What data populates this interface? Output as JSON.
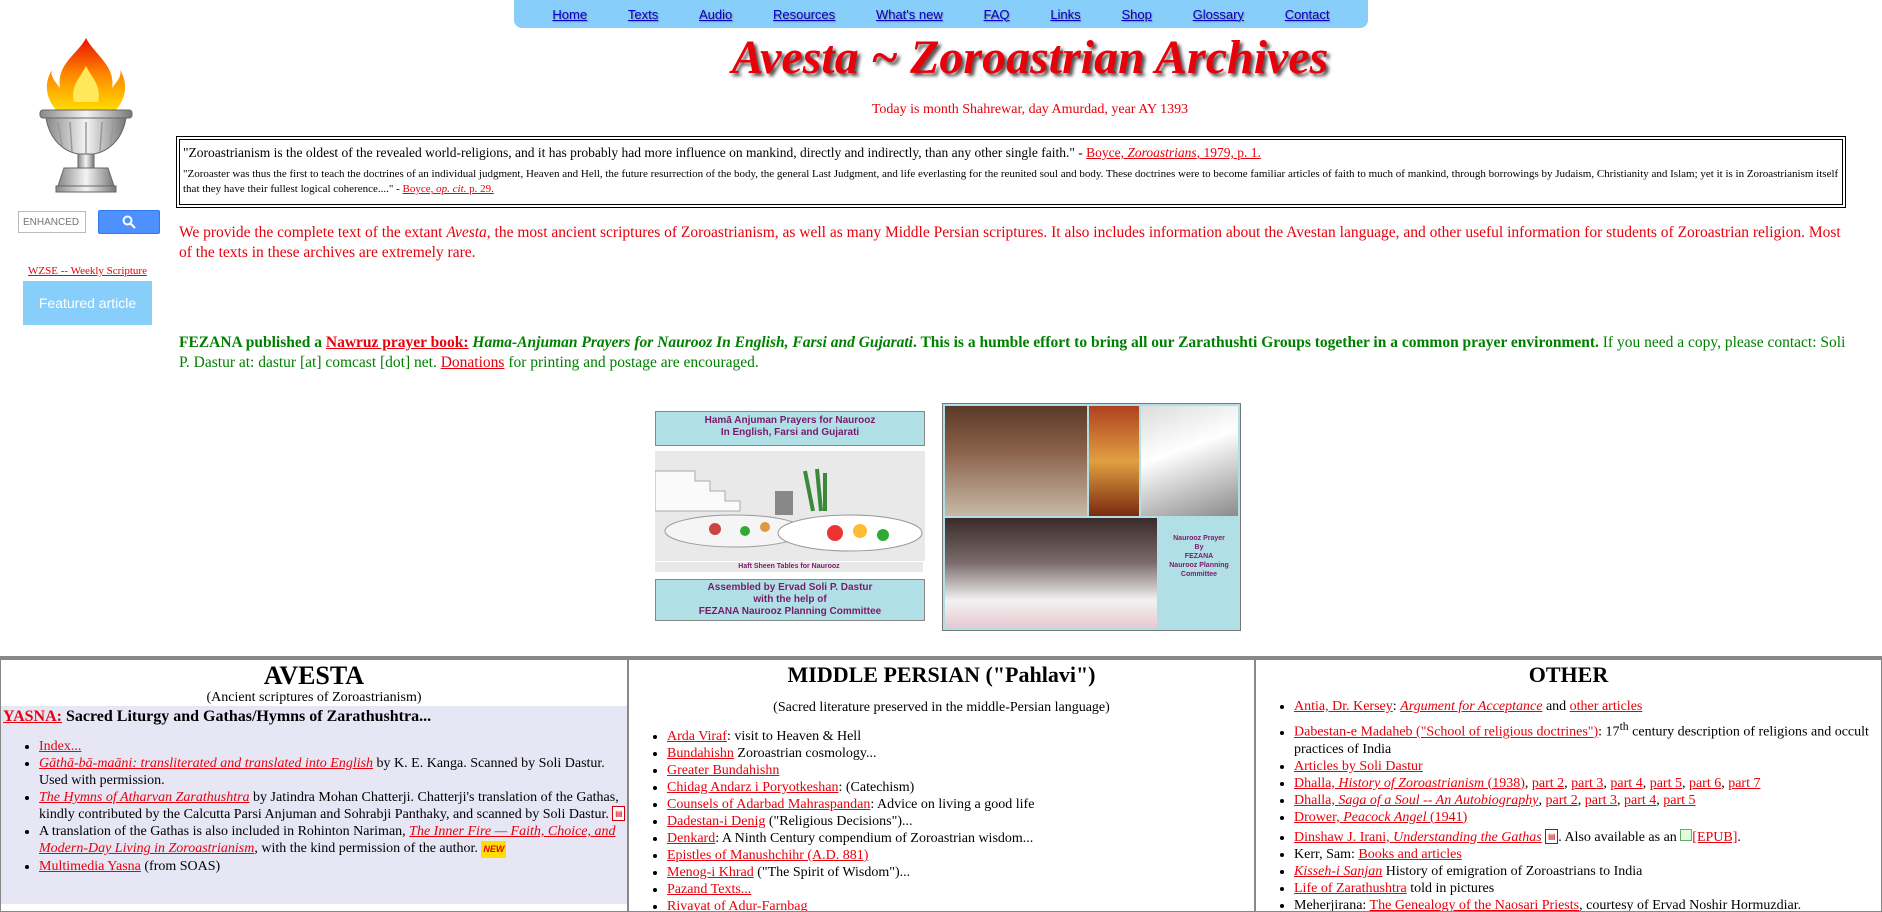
{
  "nav": [
    "Home",
    "Texts",
    "Audio",
    "Resources",
    "What's new",
    "FAQ",
    "Links",
    "Shop",
    "Glossary",
    "Contact"
  ],
  "title": "Avesta ~ Zoroastrian Archives",
  "today": "Today is month Shahrewar, day Amurdad, year AY 1393",
  "search": {
    "placeholder": "ENHANCED BY Google"
  },
  "wzse": "WZSE -- Weekly Scripture",
  "featured": "Featured article",
  "quotes": {
    "q1_text": "\"Zoroastrianism is the oldest of the revealed world-religions, and it has probably had more influence on mankind, directly and indirectly, than any other single faith.\" - ",
    "q1_cite_a": "Boyce, ",
    "q1_cite_b": "Zoroastrians",
    "q1_cite_c": ", 1979, p. 1.",
    "q2_text": "\"Zoroaster was thus the first to teach the doctrines of an individual judgment, Heaven and Hell, the future resurrection of the body, the general Last Judgment, and life everlasting for the reunited soul and body. These doctrines were to become familiar articles of faith to much of mankind, through borrowings by Judaism, Christianity and Islam; yet it is in Zoroastrianism itself that they have their fullest logical coherence....\" - ",
    "q2_cite_a": "Boyce, ",
    "q2_cite_b": "op. cit.",
    "q2_cite_c": " p. 29."
  },
  "intro": {
    "a": "We provide the complete text of the extant ",
    "b": "Avesta",
    "c": ", the most ancient scriptures of Zoroastrianism, as well as many Middle Persian scriptures. It also includes information about the Avestan language, and other useful information for students of Zoroastrian religion. Most of the texts in these archives are extremely rare."
  },
  "fezana": {
    "a": "FEZANA published a ",
    "link": "Nawruz prayer book:",
    "b": " Hama-Anjuman Prayers for Naurooz In English, Farsi and Gujarati",
    "c": ". This is a humble effort to bring all our Zarathushti Groups together in a common prayer environment.",
    "d": " If you need a copy, please contact: Soli P. Dastur at: dastur [at] comcast [dot] net. ",
    "donations": "Donations",
    "e": " for printing and postage are encouraged."
  },
  "flyer": {
    "top": "Hamā Anjuman Prayers for Naurooz\nIn English, Farsi and Gujarati",
    "caption": "Haft Sheen Tables for Naurooz",
    "bottom": "Assembled by Ervad Soli P. Dastur\nwith the help of\nFEZANA Naurooz Planning Committee",
    "right_label": "Naurooz Prayer\nBy\nFEZANA\nNaurooz Planning\nCommittee"
  },
  "avesta": {
    "heading": "AVESTA",
    "sub": "(Ancient scriptures of Zoroastrianism)",
    "yasna_link": "YASNA:",
    "yasna_text": " Sacred Liturgy and Gathas/Hymns of Zarathushtra...",
    "items": [
      {
        "link": "Index...",
        "text": ""
      },
      {
        "link": "Gāthā-bā-maāni: transliterated and translated into English",
        "text": " by K. E. Kanga. Scanned by Soli Dastur. Used with permission."
      },
      {
        "link": "The Hymns of Atharvan Zarathushtra",
        "text": " by Jatindra Mohan Chatterji. Chatterji's translation of the Gathas, kindly contributed by the Calcutta Parsi Anjuman and Sohrabji Panthaky, and scanned by Soli Dastur."
      },
      {
        "pre": "A translation of the Gathas is also included in Rohinton Nariman, ",
        "link": "The Inner Fire — Faith, Choice, and Modern-Day Living in Zoroastrianism",
        "text": ", with the kind permission of the author."
      },
      {
        "link": "Multimedia Yasna",
        "text": " (from SOAS)"
      }
    ],
    "new_badge": "NEW"
  },
  "pahlavi": {
    "heading": "MIDDLE PERSIAN (\"Pahlavi\")",
    "sub": "(Sacred literature preserved in the middle-Persian language)",
    "items": [
      {
        "link": "Arda Viraf",
        "text": ": visit to Heaven & Hell"
      },
      {
        "link": "Bundahishn",
        "text": " Zoroastrian cosmology..."
      },
      {
        "link": "Greater Bundahishn",
        "text": ""
      },
      {
        "link": "Chidag Andarz i Poryotkeshan",
        "text": ": (Catechism)"
      },
      {
        "link": "Counsels of Adarbad Mahraspandan",
        "text": ": Advice on living a good life"
      },
      {
        "link": "Dadestan-i Denig",
        "text": " (\"Religious Decisions\")..."
      },
      {
        "link": "Denkard",
        "text": ": A Ninth Century compendium of Zoroastrian wisdom..."
      },
      {
        "link": "Epistles of Manushchihr (A.D. 881)",
        "text": ""
      },
      {
        "link": "Menog-i Khrad",
        "text": " (\"The Spirit of Wisdom\")..."
      },
      {
        "link": "Pazand Texts...",
        "text": ""
      },
      {
        "link": "Rivayat of Adur-Farnbag",
        "text": ""
      }
    ]
  },
  "other": {
    "heading": "OTHER",
    "items": [
      {
        "html": "antia"
      },
      {
        "html": "dabestan"
      },
      {
        "html": "soli"
      },
      {
        "html": "dhalla1"
      },
      {
        "html": "dhalla2"
      },
      {
        "html": "drower"
      },
      {
        "html": "irani"
      },
      {
        "html": "kerr"
      },
      {
        "html": "kisseh"
      },
      {
        "html": "life"
      },
      {
        "html": "meherjirana"
      }
    ],
    "antia": {
      "a": "Antia, Dr. Kersey",
      "b": ": ",
      "c": "Argument for Acceptance",
      "d": " and ",
      "e": "other articles"
    },
    "dabestan": {
      "a": "Dabestan-e Madaheb (\"School of religious doctrines\")",
      "b": ": 17",
      "sup": "th",
      "c": " century description of religions and occult practices of India"
    },
    "soli": {
      "a": "Articles by Soli Dastur"
    },
    "dhalla1": {
      "a": "Dhalla, ",
      "b": "History of Zoroastrianism",
      "c": " (1938)",
      "p": [
        "part 2",
        "part 3",
        "part 4",
        "part 5",
        "part 6",
        "part 7"
      ]
    },
    "dhalla2": {
      "a": "Dhalla, ",
      "b": "Saga of a Soul -- An Autobiography",
      "p": [
        "part 2",
        "part 3",
        "part 4",
        "part 5"
      ]
    },
    "drower": {
      "a": "Drower, ",
      "b": "Peacock Angel",
      "c": " (1941)"
    },
    "irani": {
      "a": "Dinshaw J. Irani, ",
      "b": "Understanding the Gathas",
      "c": ". Also available as an ",
      "d": "[EPUB]",
      "e": "."
    },
    "kerr": {
      "a": "Kerr, Sam: ",
      "b": "Books and articles"
    },
    "kisseh": {
      "a": "Kisseh-i Sanjan",
      "b": " History of emigration of Zoroastrians to India"
    },
    "life": {
      "a": "Life of Zarathushtra",
      "b": " told in pictures"
    },
    "meherjirana": {
      "a": "Meherjirana: ",
      "b": "The Genealogy of the Naosari Priests",
      "c": ", courtesy of Ervad Noshir Hormuzdiar."
    }
  }
}
